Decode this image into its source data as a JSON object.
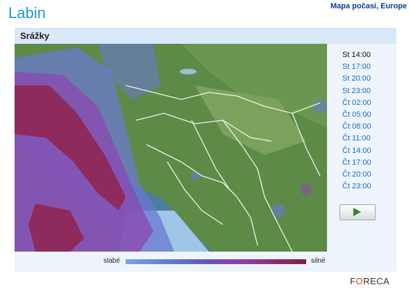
{
  "header": {
    "city": "Labin",
    "map_link": "Mapa počasí, Europe"
  },
  "panel": {
    "title": "Srážky"
  },
  "times": [
    {
      "label": "St 14:00",
      "active": true
    },
    {
      "label": "St 17:00",
      "active": false
    },
    {
      "label": "St 20:00",
      "active": false
    },
    {
      "label": "St 23:00",
      "active": false
    },
    {
      "label": "Čt 02:00",
      "active": false
    },
    {
      "label": "Čt 05:00",
      "active": false
    },
    {
      "label": "Čt 08:00",
      "active": false
    },
    {
      "label": "Čt 11:00",
      "active": false
    },
    {
      "label": "Čt 14:00",
      "active": false
    },
    {
      "label": "Čt 17:00",
      "active": false
    },
    {
      "label": "Čt 20:00",
      "active": false
    },
    {
      "label": "Čt 23:00",
      "active": false
    }
  ],
  "legend": {
    "low": "slabé",
    "high": "silné"
  },
  "brand": {
    "prefix": "F",
    "o": "O",
    "suffix": "RECA"
  },
  "icons": {
    "play": "play-icon",
    "logo": "foreca-logo"
  },
  "colors": {
    "accent": "#1a9ad6",
    "link": "#1a6fc0",
    "precip_strong": "#8a2a6c",
    "precip_weak": "#7aa3df"
  }
}
